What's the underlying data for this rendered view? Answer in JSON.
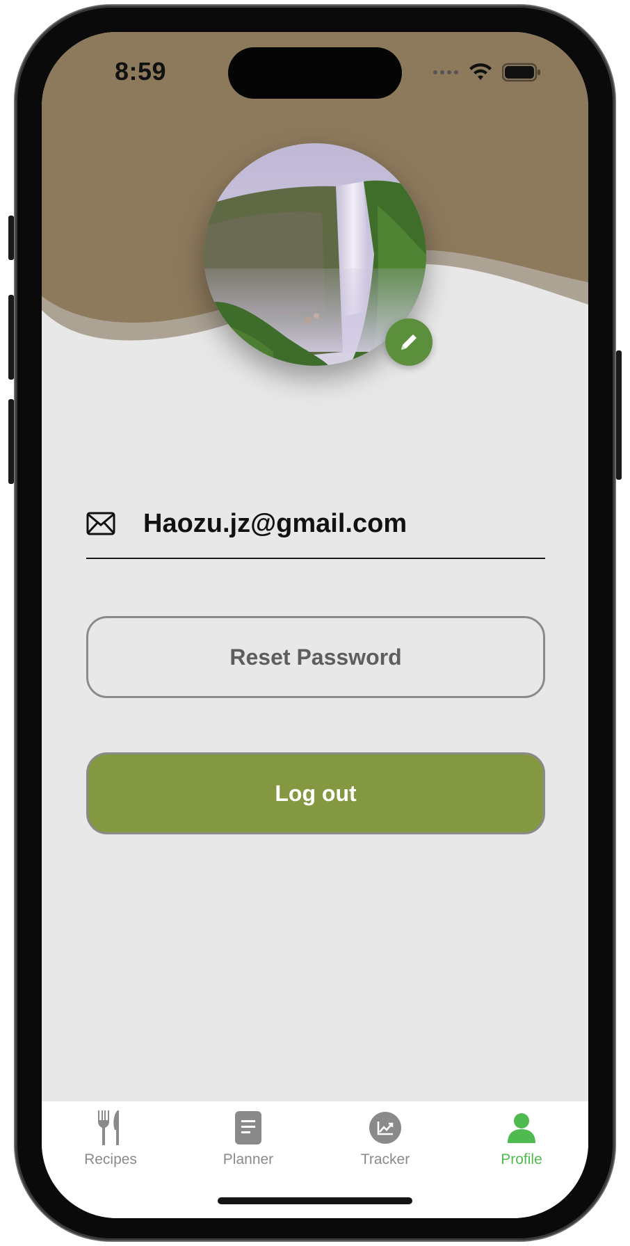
{
  "status": {
    "time": "8:59"
  },
  "profile": {
    "email": "Haozu.jz@gmail.com"
  },
  "actions": {
    "reset_label": "Reset Password",
    "logout_label": "Log out"
  },
  "tabs": [
    {
      "label": "Recipes",
      "icon": "fork-knife-icon",
      "active": false
    },
    {
      "label": "Planner",
      "icon": "document-icon",
      "active": false
    },
    {
      "label": "Tracker",
      "icon": "chart-icon",
      "active": false
    },
    {
      "label": "Profile",
      "icon": "person-icon",
      "active": true
    }
  ],
  "colors": {
    "header": "#8d7a5d",
    "background": "#e8e8e8",
    "logout": "#839841",
    "edit": "#5c8f3c",
    "active_tab": "#4fba4f",
    "inactive_tab": "#8a8a8a"
  }
}
